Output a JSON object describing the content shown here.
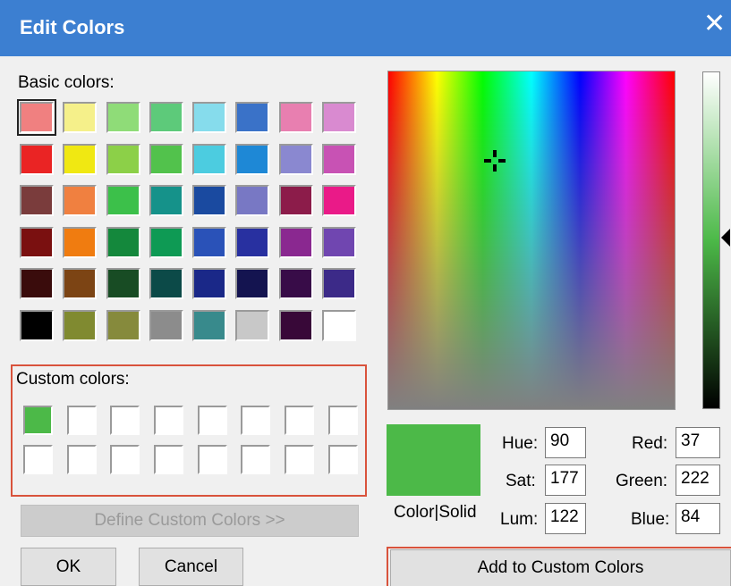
{
  "window": {
    "title": "Edit Colors",
    "close_glyph": "✕"
  },
  "basic_colors": {
    "label": "Basic colors:",
    "swatches": [
      "#f08080",
      "#f5f08a",
      "#8fdc78",
      "#5dca7a",
      "#86dcec",
      "#3a72c8",
      "#e87fb0",
      "#d98ad0",
      "#ea2424",
      "#f0e812",
      "#8cd048",
      "#52c24c",
      "#4ccce0",
      "#1e88d6",
      "#8a88d0",
      "#c852b4",
      "#7a3c3c",
      "#f08040",
      "#3cc04a",
      "#15928a",
      "#1a4aa0",
      "#7878c4",
      "#8c1c4a",
      "#ea1a88",
      "#7a1010",
      "#f07c10",
      "#14883c",
      "#0e9a54",
      "#2a52b8",
      "#2830a0",
      "#8a2890",
      "#7046b0",
      "#3a0c0c",
      "#7c4414",
      "#184c24",
      "#0c4a48",
      "#1a2888",
      "#141450",
      "#380c48",
      "#3c2a88",
      "#000000",
      "#808a30",
      "#868a3c",
      "#8c8c8c",
      "#388a8c",
      "#c8c8c8",
      "#380838",
      "#ffffff"
    ]
  },
  "custom_colors": {
    "label": "Custom colors:",
    "swatches": [
      "#4cb948",
      "#ffffff",
      "#ffffff",
      "#ffffff",
      "#ffffff",
      "#ffffff",
      "#ffffff",
      "#ffffff",
      "#ffffff",
      "#ffffff",
      "#ffffff",
      "#ffffff",
      "#ffffff",
      "#ffffff",
      "#ffffff",
      "#ffffff"
    ]
  },
  "buttons": {
    "define_custom": "Define Custom Colors >>",
    "ok": "OK",
    "cancel": "Cancel",
    "add_to_custom": "Add to Custom Colors"
  },
  "preview": {
    "label": "Color|Solid",
    "color": "#4cb948"
  },
  "fields": {
    "hue": {
      "label": "Hue:",
      "value": "90"
    },
    "sat": {
      "label": "Sat:",
      "value": "177"
    },
    "lum": {
      "label": "Lum:",
      "value": "122"
    },
    "red": {
      "label": "Red:",
      "value": "37"
    },
    "green": {
      "label": "Green:",
      "value": "222"
    },
    "blue": {
      "label": "Blue:",
      "value": "84"
    }
  },
  "accent_colors": {
    "titlebar": "#3c7fd1",
    "highlight": "#d9533c"
  }
}
